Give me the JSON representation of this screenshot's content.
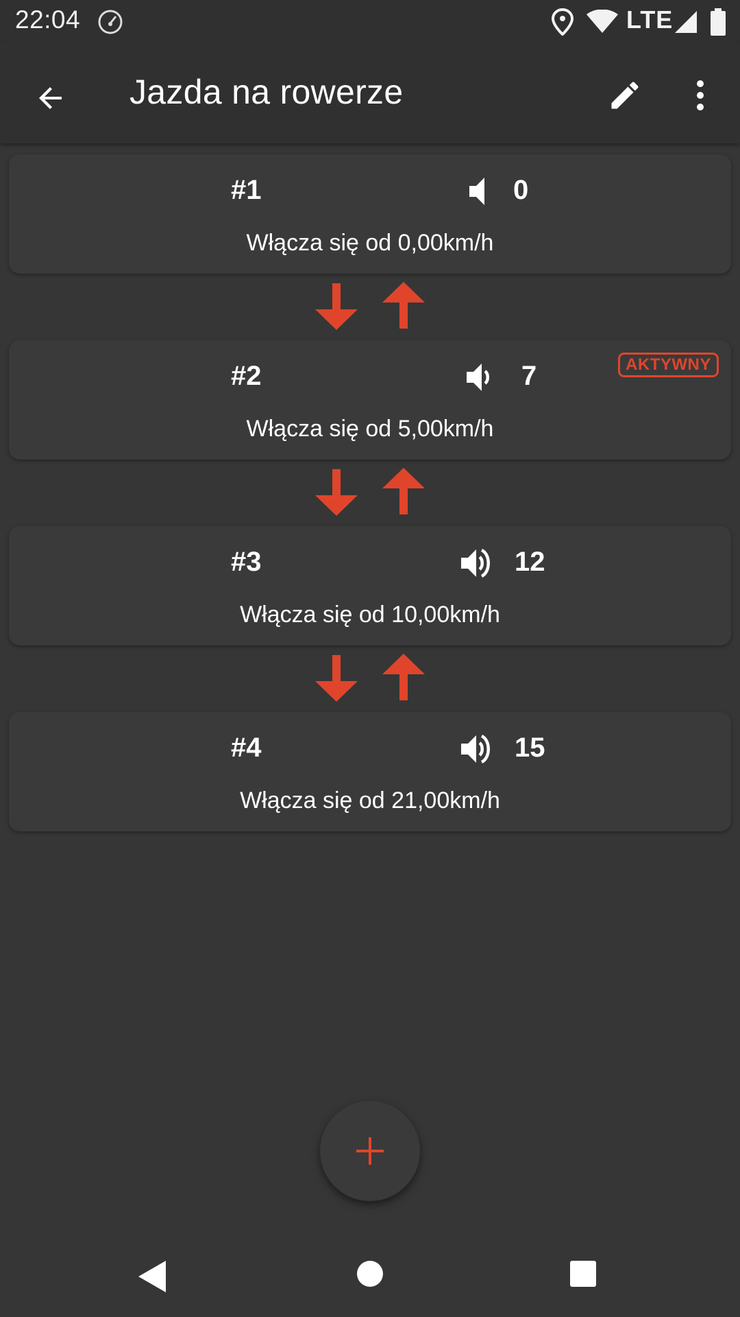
{
  "status_bar": {
    "time": "22:04",
    "network": "LTE"
  },
  "app_bar": {
    "title": "Jazda na rowerze"
  },
  "gears": [
    {
      "number": "#1",
      "volume": "0",
      "volume_icon": "volume-mute-icon",
      "description": "Włącza się od 0,00km/h",
      "active_label": ""
    },
    {
      "number": "#2",
      "volume": "7",
      "volume_icon": "volume-low-icon",
      "description": "Włącza się od 5,00km/h",
      "active_label": "AKTYWNY"
    },
    {
      "number": "#3",
      "volume": "12",
      "volume_icon": "volume-high-icon",
      "description": "Włącza się od 10,00km/h",
      "active_label": ""
    },
    {
      "number": "#4",
      "volume": "15",
      "volume_icon": "volume-high-icon",
      "description": "Włącza się od 21,00km/h",
      "active_label": ""
    }
  ],
  "colors": {
    "accent": "#e0452b",
    "background": "#363636",
    "card": "#3a3a3a",
    "bar": "#303030"
  },
  "fab": {
    "icon": "plus-icon"
  }
}
